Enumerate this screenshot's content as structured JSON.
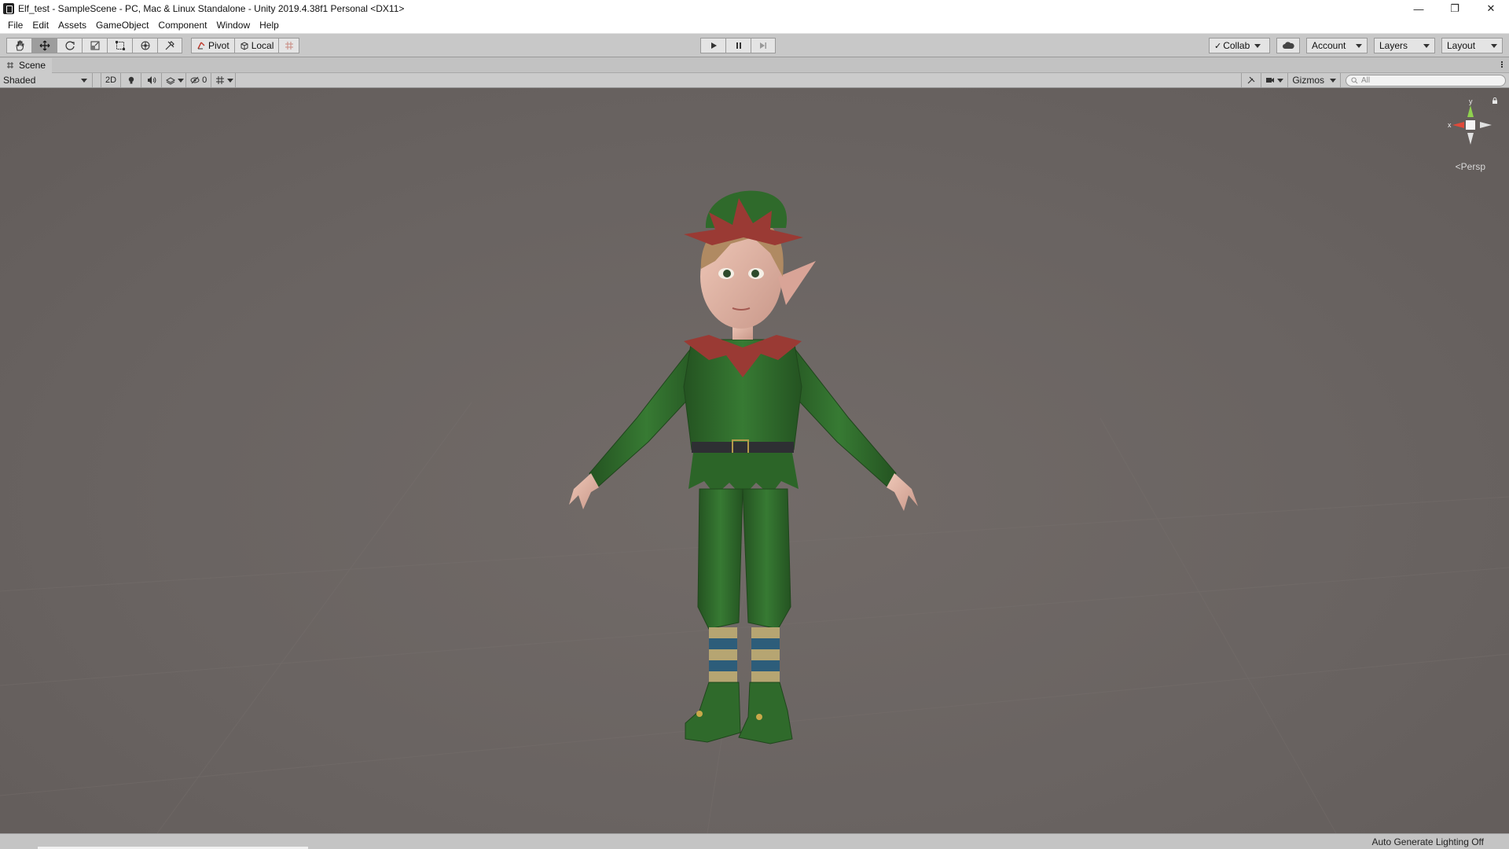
{
  "window": {
    "title": "Elf_test - SampleScene - PC, Mac & Linux Standalone - Unity 2019.4.38f1 Personal <DX11>",
    "minimize": "—",
    "maximize": "❐",
    "close": "✕"
  },
  "menu": [
    "File",
    "Edit",
    "Assets",
    "GameObject",
    "Component",
    "Window",
    "Help"
  ],
  "toolbar": {
    "tools": [
      "hand-tool",
      "move-tool",
      "rotate-tool",
      "scale-tool",
      "rect-tool",
      "transform-tool",
      "custom-tool"
    ],
    "active_tool": "move-tool",
    "pivot_label": "Pivot",
    "local_label": "Local",
    "collab_label": "Collab",
    "account_label": "Account",
    "layers_label": "Layers",
    "layout_label": "Layout"
  },
  "scene": {
    "tab_label": "Scene",
    "draw_mode": "Shaded",
    "mode_2d": "2D",
    "hidden_count": "0",
    "gizmos_label": "Gizmos",
    "search_placeholder": "All",
    "projection_label": "<Persp",
    "axis_x": "x",
    "axis_y": "y"
  },
  "status": {
    "text": "Auto Generate Lighting Off"
  },
  "colors": {
    "viewport_bg": "#6b6563",
    "elf_green": "#2f6a2b",
    "elf_red": "#9a3a34",
    "skin": "#e2b9a8",
    "hair": "#b08a62"
  }
}
